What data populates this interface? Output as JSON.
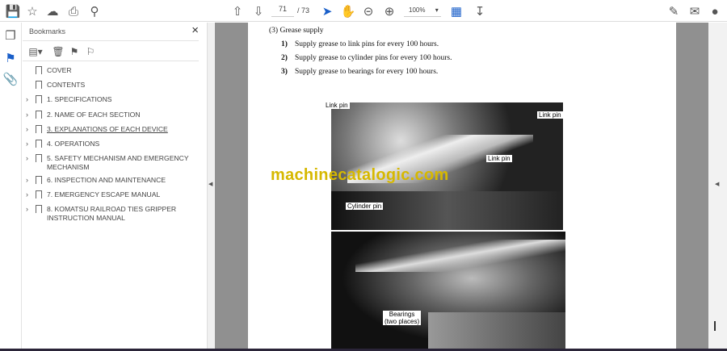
{
  "toolbar": {
    "page_current": "71",
    "page_total": "/ 73",
    "zoom": "100%"
  },
  "bookmarks": {
    "title": "Bookmarks",
    "items": [
      {
        "label": "COVER",
        "expandable": false
      },
      {
        "label": "CONTENTS",
        "expandable": false
      },
      {
        "label": "1. SPECIFICATIONS",
        "expandable": true
      },
      {
        "label": "2. NAME OF EACH SECTION",
        "expandable": true
      },
      {
        "label": "3. EXPLANATIONS OF EACH DEVICE",
        "expandable": true
      },
      {
        "label": "4. OPERATIONS",
        "expandable": true
      },
      {
        "label": "5. SAFETY MECHANISM AND EMERGENCY MECHANISM",
        "expandable": true
      },
      {
        "label": "6. INSPECTION AND MAINTENANCE",
        "expandable": true
      },
      {
        "label": "7. EMERGENCY ESCAPE MANUAL",
        "expandable": true
      },
      {
        "label": "8. KOMATSU RAILROAD TIES GRIPPER INSTRUCTION MANUAL",
        "expandable": true
      }
    ]
  },
  "document": {
    "heading": "(3)  Grease supply",
    "steps": [
      {
        "num": "1)",
        "text": "Supply grease to link pins for every 100 hours."
      },
      {
        "num": "2)",
        "text": "Supply grease to cylinder pins for every 100 hours."
      },
      {
        "num": "3)",
        "text": "Supply grease to bearings for every 100 hours."
      }
    ],
    "labels": {
      "link_pin_1": "Link pin",
      "link_pin_2": "Link pin",
      "link_pin_3": "Link pin",
      "cylinder_pin": "Cylinder pin",
      "bearings": "Bearings",
      "bearings_sub": "(two places)"
    },
    "watermark": "machinecatalogic.com"
  }
}
